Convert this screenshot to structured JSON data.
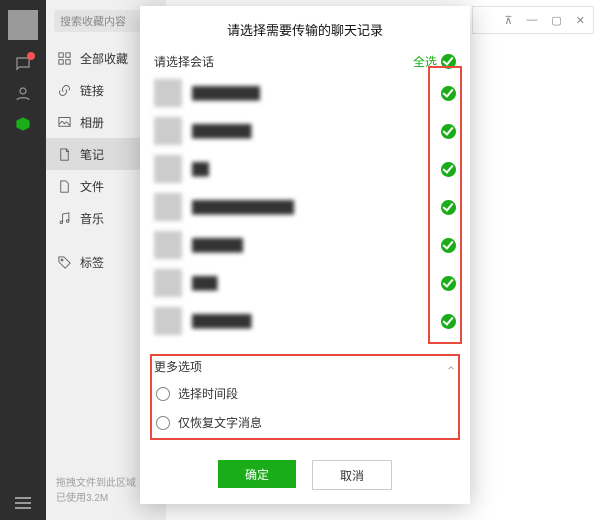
{
  "rail": {
    "items": [
      "chat",
      "contacts",
      "favorites"
    ]
  },
  "sidebar": {
    "search_placeholder": "搜索收藏内容",
    "items": [
      {
        "label": "全部收藏"
      },
      {
        "label": "链接"
      },
      {
        "label": "相册"
      },
      {
        "label": "笔记"
      },
      {
        "label": "文件"
      },
      {
        "label": "音乐"
      },
      {
        "label": "标签"
      }
    ],
    "footer_line1": "拖拽文件到此区域",
    "footer_line2": "已使用3.2M"
  },
  "modal": {
    "title": "请选择需要传输的聊天记录",
    "select_label": "请选择会话",
    "select_all_label": "全选",
    "chats": [
      {
        "name": "████████"
      },
      {
        "name": "███████"
      },
      {
        "name": "██"
      },
      {
        "name": "████████████"
      },
      {
        "name": "██████"
      },
      {
        "name": "███"
      },
      {
        "name": "███████"
      }
    ],
    "more_label": "更多选项",
    "opt_time": "选择时间段",
    "opt_text_only": "仅恢复文字消息",
    "ok": "确定",
    "cancel": "取消"
  }
}
